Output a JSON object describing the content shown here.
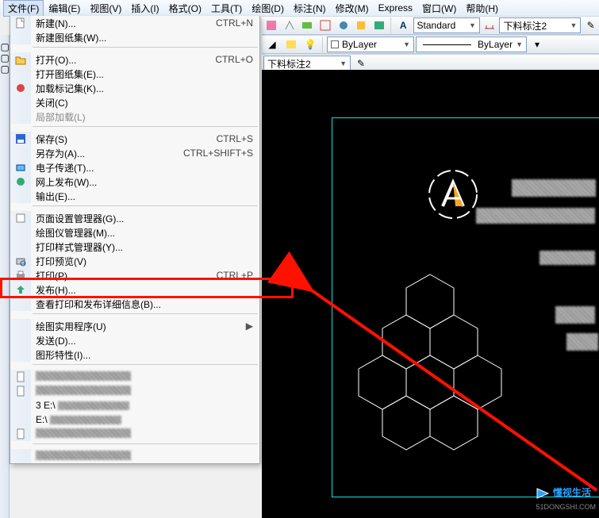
{
  "menubar": {
    "items": [
      {
        "label": "文件(F)",
        "active": true
      },
      {
        "label": "编辑(E)"
      },
      {
        "label": "视图(V)"
      },
      {
        "label": "插入(I)"
      },
      {
        "label": "格式(O)"
      },
      {
        "label": "工具(T)"
      },
      {
        "label": "绘图(D)"
      },
      {
        "label": "标注(N)"
      },
      {
        "label": "修改(M)"
      },
      {
        "label": "Express"
      },
      {
        "label": "窗口(W)"
      },
      {
        "label": "帮助(H)"
      }
    ]
  },
  "toolbar": {
    "combo_standard": "Standard",
    "combo_dim": "下料标注2",
    "combo_layer_color": "ByLayer",
    "combo_layer_line": "ByLayer",
    "combo_layer_dim": "下料标注2"
  },
  "file_menu": {
    "items": [
      {
        "type": "item",
        "icon": "new-file-icon",
        "label": "新建(N)...",
        "shortcut": "CTRL+N"
      },
      {
        "type": "item",
        "icon": "",
        "label": "新建图纸集(W)...",
        "shortcut": ""
      },
      {
        "type": "sep"
      },
      {
        "type": "item",
        "icon": "open-file-icon",
        "label": "打开(O)...",
        "shortcut": "CTRL+O"
      },
      {
        "type": "item",
        "icon": "",
        "label": "打开图纸集(E)...",
        "shortcut": ""
      },
      {
        "type": "item",
        "icon": "markup-icon",
        "label": "加载标记集(K)...",
        "shortcut": ""
      },
      {
        "type": "item",
        "icon": "",
        "label": "关闭(C)",
        "shortcut": ""
      },
      {
        "type": "item",
        "icon": "",
        "label": "局部加载(L)",
        "shortcut": "",
        "dim": true
      },
      {
        "type": "sep"
      },
      {
        "type": "item",
        "icon": "save-icon",
        "label": "保存(S)",
        "shortcut": "CTRL+S"
      },
      {
        "type": "item",
        "icon": "",
        "label": "另存为(A)...",
        "shortcut": "CTRL+SHIFT+S"
      },
      {
        "type": "item",
        "icon": "etransmit-icon",
        "label": "电子传递(T)...",
        "shortcut": ""
      },
      {
        "type": "item",
        "icon": "webpublish-icon",
        "label": "网上发布(W)...",
        "shortcut": ""
      },
      {
        "type": "item",
        "icon": "",
        "label": "输出(E)...",
        "shortcut": ""
      },
      {
        "type": "sep"
      },
      {
        "type": "item",
        "icon": "page-setup-icon",
        "label": "页面设置管理器(G)...",
        "shortcut": ""
      },
      {
        "type": "item",
        "icon": "",
        "label": "绘图仪管理器(M)...",
        "shortcut": ""
      },
      {
        "type": "item",
        "icon": "",
        "label": "打印样式管理器(Y)...",
        "shortcut": ""
      },
      {
        "type": "item",
        "icon": "print-preview-icon",
        "label": "打印预览(V)",
        "shortcut": ""
      },
      {
        "type": "item",
        "icon": "print-icon",
        "label": "打印(P)...",
        "shortcut": "CTRL+P",
        "hl": true
      },
      {
        "type": "item",
        "icon": "publish-icon",
        "label": "发布(H)...",
        "shortcut": ""
      },
      {
        "type": "item",
        "icon": "",
        "label": "查看打印和发布详细信息(B)...",
        "shortcut": ""
      },
      {
        "type": "sep"
      },
      {
        "type": "item",
        "icon": "",
        "label": "绘图实用程序(U)",
        "shortcut": "",
        "arrow": true
      },
      {
        "type": "item",
        "icon": "",
        "label": "发送(D)...",
        "shortcut": ""
      },
      {
        "type": "item",
        "icon": "",
        "label": "图形特性(I)...",
        "shortcut": ""
      },
      {
        "type": "sep"
      },
      {
        "type": "item",
        "icon": "doc-icon",
        "label": "",
        "pixelated": true
      },
      {
        "type": "item",
        "icon": "doc-icon",
        "label": "",
        "pixelated": true
      },
      {
        "type": "item",
        "icon": "",
        "label": "3 E:\\",
        "shortcut": "",
        "pixelated_tail": true
      },
      {
        "type": "item",
        "icon": "",
        "label": "E:\\",
        "shortcut": "",
        "pixelated_tail": true
      },
      {
        "type": "item",
        "icon": "doc-icon",
        "label": "",
        "pixelated": true
      },
      {
        "type": "sep"
      },
      {
        "type": "item",
        "icon": "",
        "label": "",
        "pixelated": true
      }
    ]
  },
  "watermark": {
    "brand_cn": "懂视生活",
    "domain": "51DONGSHI.COM"
  }
}
